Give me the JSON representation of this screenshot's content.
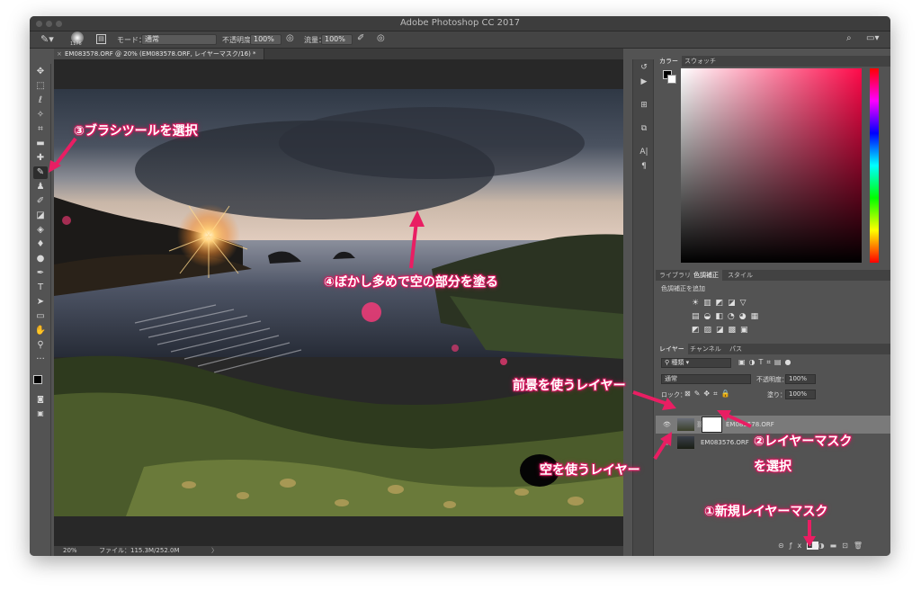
{
  "window": {
    "title": "Adobe Photoshop CC 2017"
  },
  "options_bar": {
    "brush_size": "1176",
    "mode_label": "モード：",
    "mode_value": "通常",
    "opacity_label": "不透明度：",
    "opacity_value": "100%",
    "flow_label": "流量：",
    "flow_value": "100%"
  },
  "document": {
    "tab_label": "EM083578.ORF @ 20% (EM083578.ORF, レイヤーマスク/16) *",
    "status_zoom": "20%",
    "status_file": "ファイル：115.3M/252.0M"
  },
  "panels": {
    "color_tabs": [
      "カラー",
      "スウォッチ"
    ],
    "adjust_tabs": [
      "ライブラリ",
      "色調補正",
      "スタイル"
    ],
    "adjust_heading": "色調補正を追加",
    "layer_tabs": [
      "レイヤー",
      "チャンネル",
      "パス"
    ],
    "layer_filter": "種類",
    "blend_mode": "通常",
    "opacity_label": "不透明度：",
    "opacity_value": "100%",
    "lock_label": "ロック：",
    "fill_label": "塗り：",
    "fill_value": "100%",
    "layers": [
      {
        "name": "EM083578.ORF"
      },
      {
        "name": "EM083576.ORF"
      }
    ]
  },
  "annotations": {
    "step1": "①新規レイヤーマスク",
    "step2_line1": "②レイヤーマスク",
    "step2_line2": "を選択",
    "step3": "③ブラシツールを選択",
    "step4": "④ぼかし多めで空の部分を塗る",
    "foreground": "前景を使うレイヤー",
    "sky": "空を使うレイヤー"
  },
  "colors": {
    "annotation_pink": "#e91e63",
    "ui_dark": "#535353"
  }
}
